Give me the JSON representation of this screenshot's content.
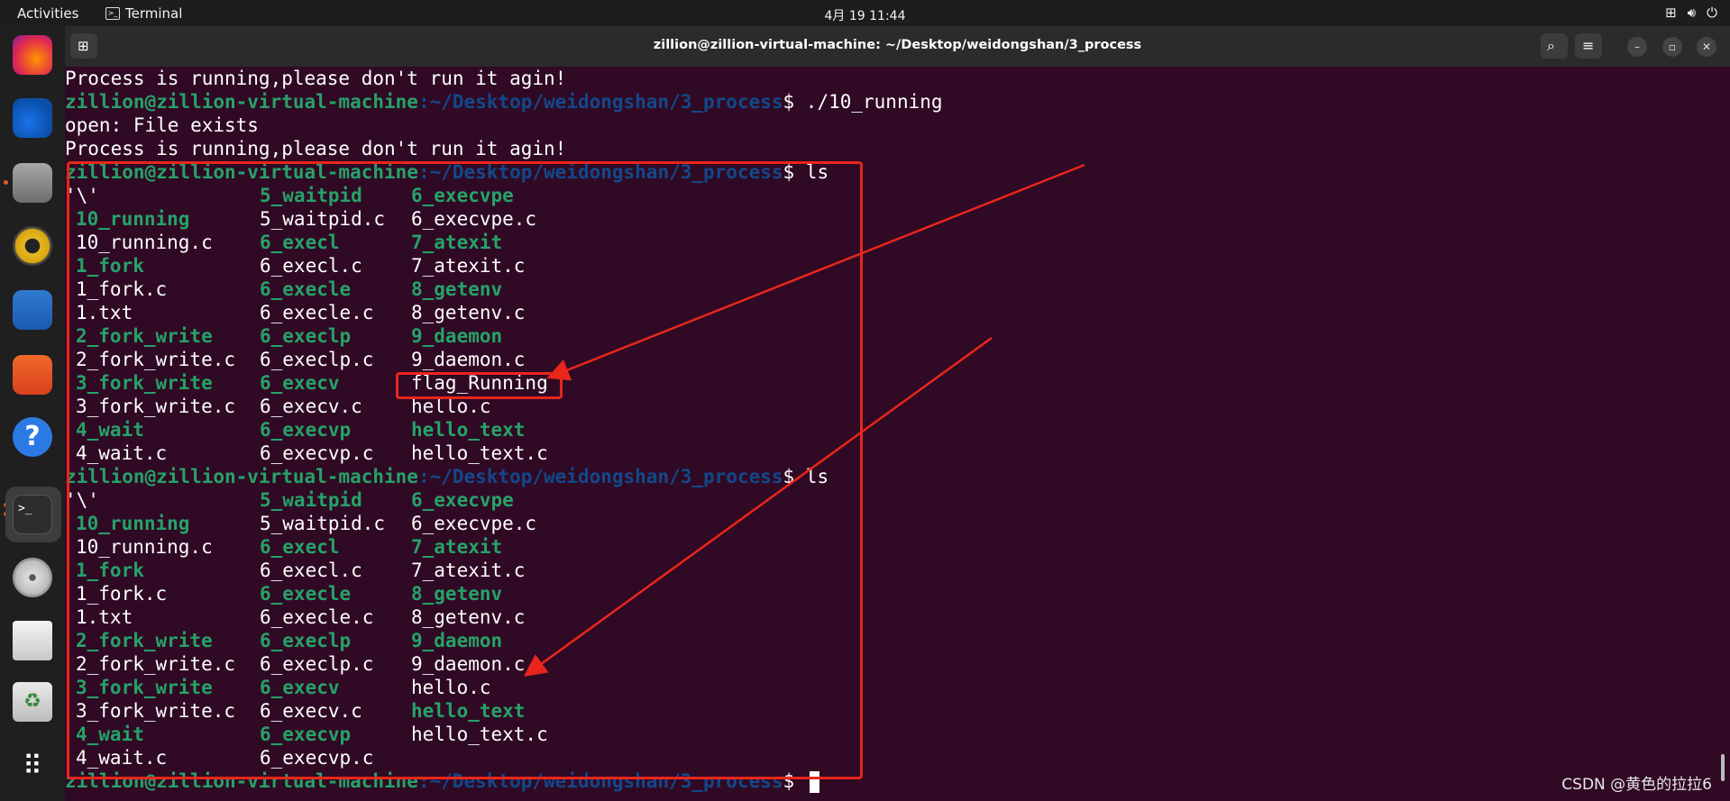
{
  "topbar": {
    "activities": "Activities",
    "app_name": "Terminal",
    "app_icon": ">_",
    "clock": "4月 19  11:44",
    "tray_icons": [
      "network-icon",
      "volume-icon",
      "power-icon"
    ]
  },
  "window": {
    "title": "zillion@zillion-virtual-machine: ~/Desktop/weidongshan/3_process",
    "new_tab_icon": "new-tab-icon",
    "search_icon": "search-icon",
    "menu_icon": "hamburger-menu-icon",
    "minimize": "–",
    "maximize": "▫",
    "close": "✕"
  },
  "dock": {
    "items": [
      "Firefox",
      "Thunderbird",
      "Files",
      "Rhythmbox",
      "LibreOffice Writer",
      "Ubuntu Software",
      "Help",
      "Terminal",
      "DVD",
      "Disk Image",
      "Trash",
      "Show Applications"
    ]
  },
  "terminal": {
    "user": "zillion@zillion-virtual-machine",
    "path": ":~/Desktop/weidongshan/3_process",
    "lines_top": [
      "Process is running,please don't run it agin!",
      "open: File exists",
      "Process is running,please don't run it agin!"
    ],
    "cmd_run": "$ ./10_running",
    "cmd_ls": "$ ls",
    "cmd_end": "$ ",
    "listing1": [
      [
        "'\\'",
        "5_waitpid",
        "6_execvpe"
      ],
      [
        "10_running",
        "5_waitpid.c",
        "6_execvpe.c"
      ],
      [
        "10_running.c",
        "6_execl",
        "7_atexit"
      ],
      [
        "1_fork",
        "6_execl.c",
        "7_atexit.c"
      ],
      [
        "1_fork.c",
        "6_execle",
        "8_getenv"
      ],
      [
        "1.txt",
        "6_execle.c",
        "8_getenv.c"
      ],
      [
        "2_fork_write",
        "6_execlp",
        "9_daemon"
      ],
      [
        "2_fork_write.c",
        "6_execlp.c",
        "9_daemon.c"
      ],
      [
        "3_fork_write",
        "6_execv",
        "flag_Running"
      ],
      [
        "3_fork_write.c",
        "6_execv.c",
        "hello.c"
      ],
      [
        "4_wait",
        "6_execvp",
        "hello_text"
      ],
      [
        "4_wait.c",
        "6_execvp.c",
        "hello_text.c"
      ]
    ],
    "listing2": [
      [
        "'\\'",
        "5_waitpid",
        "6_execvpe"
      ],
      [
        "10_running",
        "5_waitpid.c",
        "6_execvpe.c"
      ],
      [
        "10_running.c",
        "6_execl",
        "7_atexit"
      ],
      [
        "1_fork",
        "6_execl.c",
        "7_atexit.c"
      ],
      [
        "1_fork.c",
        "6_execle",
        "8_getenv"
      ],
      [
        "1.txt",
        "6_execle.c",
        "8_getenv.c"
      ],
      [
        "2_fork_write",
        "6_execlp",
        "9_daemon"
      ],
      [
        "2_fork_write.c",
        "6_execlp.c",
        "9_daemon.c"
      ],
      [
        "3_fork_write",
        "6_execv",
        "hello.c"
      ],
      [
        "3_fork_write.c",
        "6_execv.c",
        "hello_text"
      ],
      [
        "4_wait",
        "6_execvp",
        "hello_text.c"
      ],
      [
        "4_wait.c",
        "6_execvp.c",
        ""
      ]
    ],
    "executables": [
      "10_running",
      "1_fork",
      "2_fork_write",
      "3_fork_write",
      "4_wait",
      "5_waitpid",
      "6_execvpe",
      "6_execl",
      "7_atexit",
      "6_execle",
      "8_getenv",
      "6_execlp",
      "9_daemon",
      "6_execv",
      "6_execvp",
      "hello_text"
    ]
  },
  "watermark": "CSDN @黄色的拉拉6",
  "colors": {
    "background": "#300a24",
    "prompt_user": "#26a269",
    "prompt_path": "#12488b",
    "annotation": "#e8261c"
  }
}
